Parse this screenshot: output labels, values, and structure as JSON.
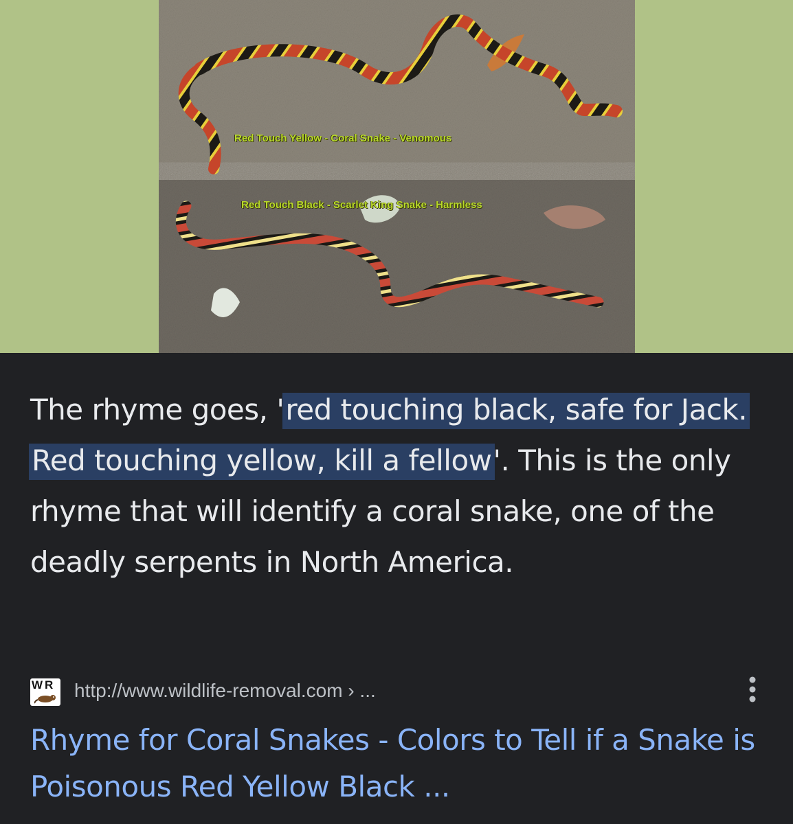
{
  "image": {
    "caption_top": "Red Touch Yellow - Coral Snake - Venomous",
    "caption_bottom": "Red Touch Black - Scarlet King Snake - Harmless",
    "band_color": "#b0c287"
  },
  "snippet": {
    "intro": "The rhyme goes, '",
    "highlight_1": "red touching black, safe for Jack.",
    "space": " ",
    "highlight_2": "Red touching yellow, kill a fellow",
    "after": "'. This is the only rhyme that will identify a coral snake, one of the deadly serpents in North America.",
    "highlight_color": "#2a3f63"
  },
  "source": {
    "favicon_text": "WR",
    "favicon_icon": "rodent-logo-icon",
    "url": "http://www.wildlife-removal.com › ...",
    "more_icon": "more-vert-icon"
  },
  "result": {
    "title": "Rhyme for Coral Snakes - Colors to Tell if a Snake is Poisonous Red Yellow Black ...",
    "link_color": "#8ab4f8"
  }
}
